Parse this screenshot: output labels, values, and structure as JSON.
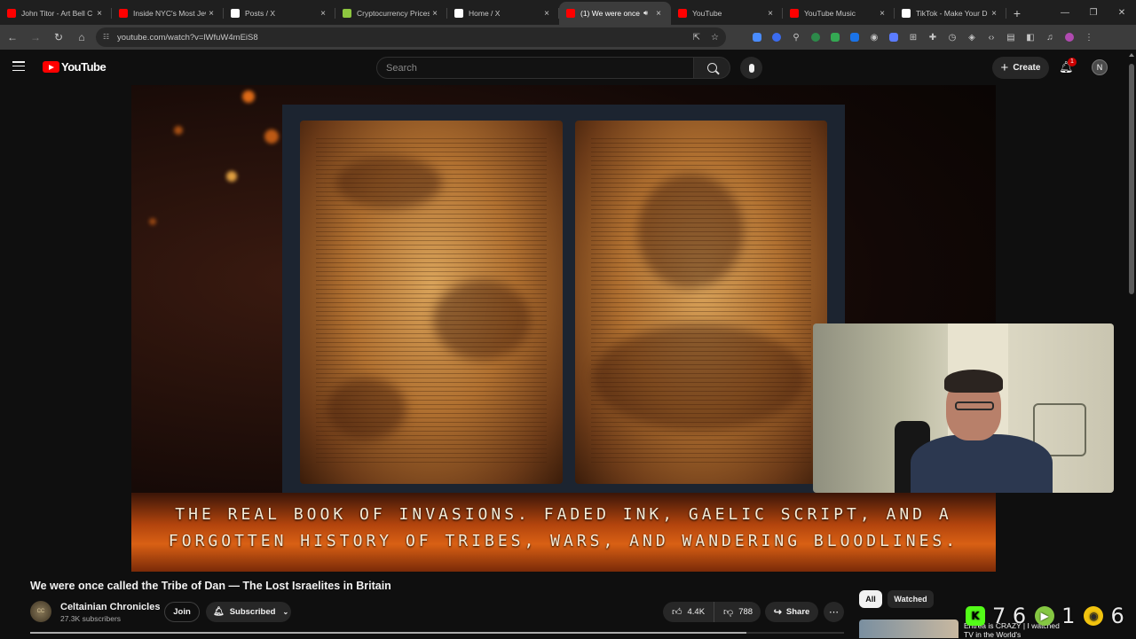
{
  "browser": {
    "tabs": [
      {
        "label": "John Titor - Art Bell C",
        "icon_color": "#ff0000"
      },
      {
        "label": "Inside NYC's Most Jew",
        "icon_color": "#ff0000"
      },
      {
        "label": "Posts / X",
        "icon_color": "#ffffff"
      },
      {
        "label": "Cryptocurrency Prices",
        "icon_color": "#8dc63f"
      },
      {
        "label": "Home / X",
        "icon_color": "#ffffff"
      },
      {
        "label": "(1) We were once",
        "icon_color": "#ff0000",
        "active": true
      },
      {
        "label": "YouTube",
        "icon_color": "#ff0000"
      },
      {
        "label": "YouTube Music",
        "icon_color": "#ff0000"
      },
      {
        "label": "TikTok - Make Your D",
        "icon_color": "#ffffff"
      }
    ],
    "new_tab": "+",
    "window_controls": [
      "—",
      "❐",
      "✕"
    ],
    "url": "youtube.com/watch?v=lWfuW4mEiS8"
  },
  "youtube": {
    "logo_text": "YouTube",
    "search_placeholder": "Search",
    "create_label": "Create",
    "notification_count": "1",
    "avatar_initial": "N"
  },
  "video": {
    "caption_line1": "The real Book of Invasions. Faded ink, Gaelic script, and a",
    "caption_line2": "forgotten history of tribes, wars, and wandering bloodlines.",
    "title": "We were once called the Tribe of Dan — The Lost Israelites in Britain",
    "channel_name": "Celtainian Chronicles",
    "subscribers": "27.3K subscribers",
    "join_label": "Join",
    "subscribed_label": "Subscribed",
    "likes": "4.4K",
    "dislikes": "788",
    "share_label": "Share",
    "progress_fraction": 0.88
  },
  "sidebar": {
    "chips": [
      "All",
      "Watched"
    ],
    "rec_title": "Eritrea is CRAZY | I watched TV in the World's"
  },
  "overlay_counters": [
    {
      "platform": "kick",
      "value": "7 6"
    },
    {
      "platform": "rumble",
      "value": "1"
    },
    {
      "platform": "gamer",
      "value": "6"
    }
  ],
  "colors": {
    "accent_red": "#ff0000",
    "page_bg": "#0f0f0f"
  }
}
